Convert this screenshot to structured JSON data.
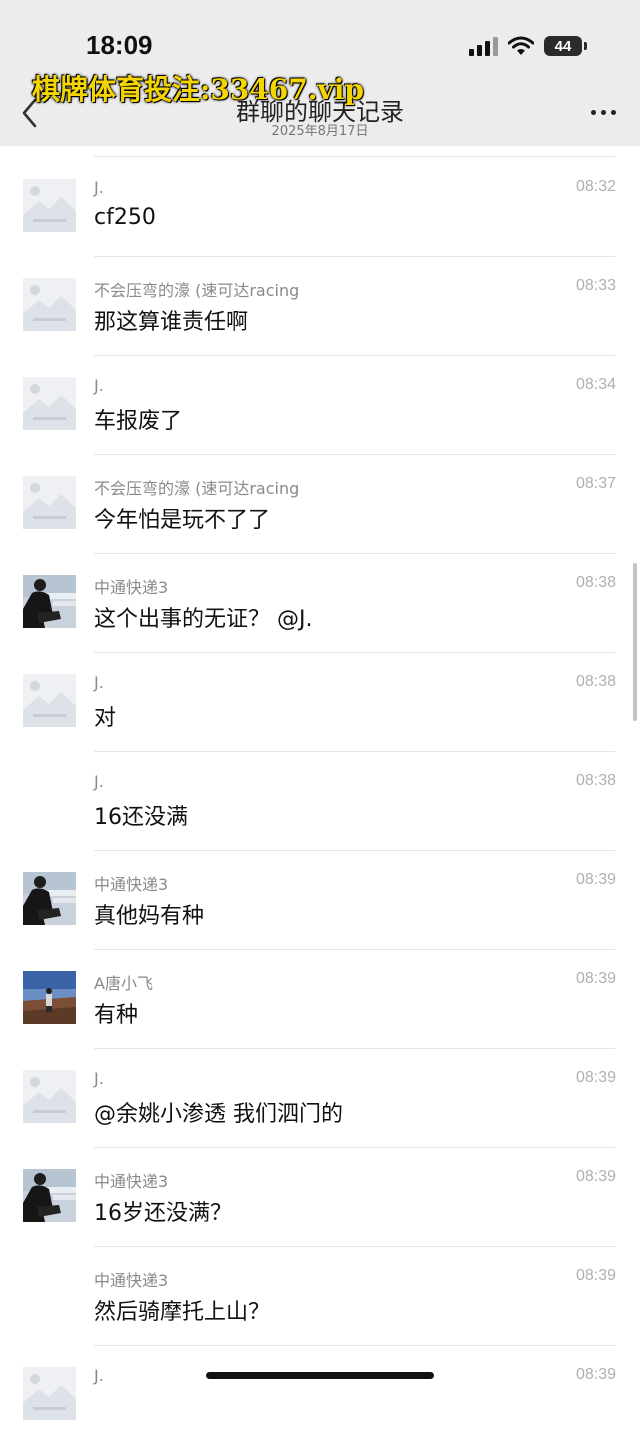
{
  "status_bar": {
    "time": "18:09",
    "battery": "44"
  },
  "watermark": "棋牌体育投注:33467.vip",
  "header": {
    "title": "群聊的聊天记录",
    "date": "2025年8月17日"
  },
  "messages": [
    {
      "sender": "J.",
      "time": "08:32",
      "text": "cf250",
      "avatar": "placeholder"
    },
    {
      "sender": "不会压弯的濠 (速可达racing",
      "time": "08:33",
      "text": "那这算谁责任啊",
      "avatar": "placeholder"
    },
    {
      "sender": "J.",
      "time": "08:34",
      "text": "车报废了",
      "avatar": "placeholder"
    },
    {
      "sender": "不会压弯的濠 (速可达racing",
      "time": "08:37",
      "text": "今年怕是玩不了了",
      "avatar": "placeholder"
    },
    {
      "sender": "中通快递3",
      "time": "08:38",
      "text": "这个出事的无证？ @J.",
      "avatar": "person-photo"
    },
    {
      "sender": "J.",
      "time": "08:38",
      "text": "对",
      "avatar": "placeholder"
    },
    {
      "sender": "J.",
      "time": "08:38",
      "text": "16还没满",
      "avatar": "none"
    },
    {
      "sender": "中通快递3",
      "time": "08:39",
      "text": "真他妈有种",
      "avatar": "person-photo"
    },
    {
      "sender": "A唐小飞",
      "time": "08:39",
      "text": "有种",
      "avatar": "landscape-photo"
    },
    {
      "sender": "J.",
      "time": "08:39",
      "text": "@余姚小渗透 我们泗门的",
      "avatar": "placeholder"
    },
    {
      "sender": "中通快递3",
      "time": "08:39",
      "text": "16岁还没满？",
      "avatar": "person-photo"
    },
    {
      "sender": "中通快递3",
      "time": "08:39",
      "text": "然后骑摩托上山？",
      "avatar": "none"
    },
    {
      "sender": "J.",
      "time": "08:39",
      "text": "",
      "avatar": "placeholder"
    }
  ],
  "icons": {
    "back": "chevron-left-icon",
    "more": "more-dots-icon",
    "signal": "cellular-signal-icon",
    "wifi": "wifi-icon",
    "battery": "battery-icon"
  }
}
